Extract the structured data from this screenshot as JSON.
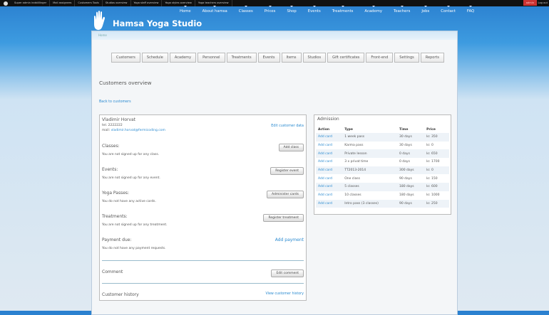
{
  "topbar": {
    "links": [
      "Super admin indstillinger",
      "Mail assignees",
      "Customers Tools",
      "Studios overview",
      "Yoga staff overview",
      "Yoga styles overview",
      "Yoga teachers overview"
    ],
    "admin": "admin",
    "logout": "Log out"
  },
  "site": {
    "name": "Hamsa Yoga Studio"
  },
  "nav": [
    "Home",
    "About hamsa",
    "Classes",
    "Prices",
    "Shop",
    "Events",
    "Treatments",
    "Academy",
    "Teachers",
    "Jobs",
    "Contact",
    "FAQ"
  ],
  "breadcrumb": "Home",
  "tabs": [
    "Customers",
    "Schedule",
    "Academy",
    "Personnel",
    "Treatments",
    "Events",
    "Items",
    "Studios",
    "Gift certificates",
    "Front-end",
    "Settings",
    "Reports"
  ],
  "page_title": "Customers overview",
  "back": "Back to customers",
  "customer": {
    "name": "Vladimir Horvat",
    "tel": "tel. 2222222",
    "mail_label": "mail:",
    "mail": "vladimir.horvat@fermicoding.com",
    "edit": "Edit customer data"
  },
  "sections": {
    "classes": {
      "title": "Classes:",
      "text": "You are not signed up for any class.",
      "button": "Add class"
    },
    "events": {
      "title": "Events:",
      "text": "You are not signed up for any event.",
      "button": "Register event"
    },
    "passes": {
      "title": "Yoga Passes:",
      "text": "You do not have any active cards.",
      "button": "Administer cards"
    },
    "treatments": {
      "title": "Treatments:",
      "text": "You are not signed up for any treatment.",
      "button": "Register treatment"
    },
    "payment": {
      "title": "Payment due:",
      "text": "You do not have any payment requests.",
      "button": "Add payment"
    },
    "comment": {
      "title": "Comment",
      "button": "Edit comment"
    },
    "history": {
      "title": "Customer history",
      "button": "View customer history"
    }
  },
  "admission": {
    "title": "Admission",
    "headers": [
      "Action",
      "Type",
      "Time",
      "Price"
    ],
    "rows": [
      [
        "Add card",
        "1 week pass",
        "30 days",
        "kr. 350"
      ],
      [
        "Add card",
        "Karma pass",
        "30 days",
        "kr. 0"
      ],
      [
        "Add card",
        "Private lesson",
        "0 days",
        "kr. 650"
      ],
      [
        "Add card",
        "3 x privat time",
        "0 days",
        "kr. 1700"
      ],
      [
        "Add card",
        "TT2013-2014",
        "300 days",
        "kr. 0"
      ],
      [
        "Add card",
        "One class",
        "90 days",
        "kr. 150"
      ],
      [
        "Add card",
        "5 classes",
        "180 days",
        "kr. 600"
      ],
      [
        "Add card",
        "10 classes",
        "180 days",
        "kr. 1000"
      ],
      [
        "Add card",
        "Intro pass (3 classes)",
        "90 days",
        "kr. 250"
      ]
    ]
  }
}
